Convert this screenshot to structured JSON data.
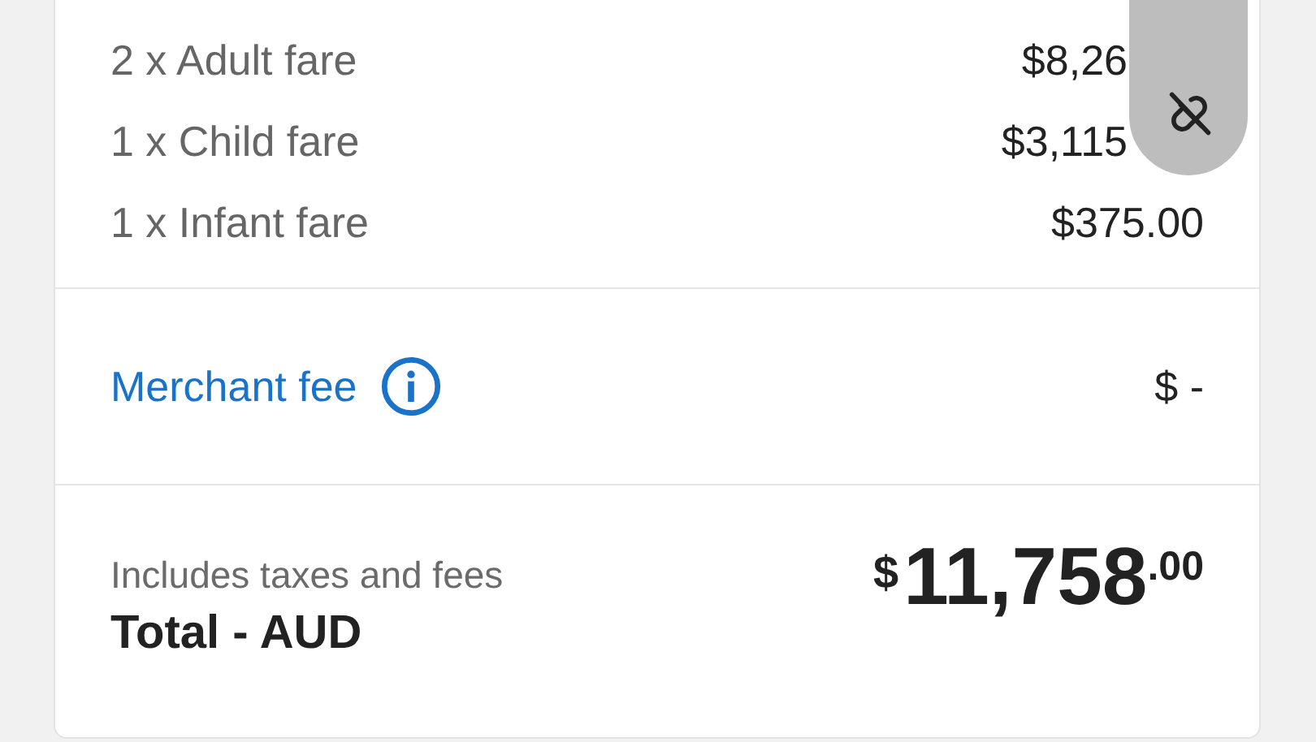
{
  "fares": [
    {
      "label": "2 x Adult fare",
      "amount": "$8,26",
      "covered": true
    },
    {
      "label": "1 x Child fare",
      "amount": "$3,115",
      "covered": true
    },
    {
      "label": "1 x Infant fare",
      "amount": "$375.00"
    }
  ],
  "merchant_fee": {
    "label": "Merchant fee",
    "amount": "$ -"
  },
  "total": {
    "note": "Includes taxes and fees",
    "label": "Total - AUD",
    "currency": "$",
    "whole": "11,758",
    "cents": ".00"
  }
}
